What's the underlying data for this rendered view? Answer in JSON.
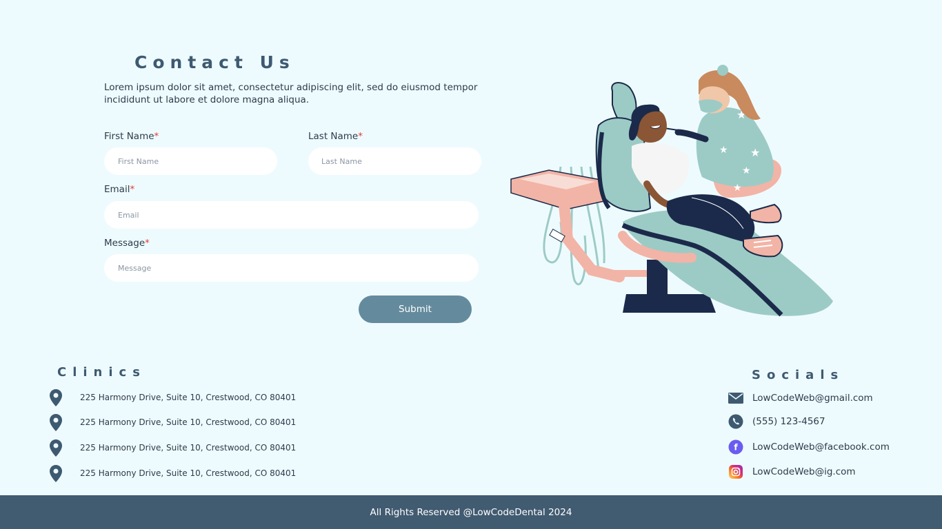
{
  "contact": {
    "title": "Contact Us",
    "description": "Lorem ipsum dolor sit amet, consectetur adipiscing elit, sed do eiusmod tempor incididunt ut labore et dolore magna aliqua."
  },
  "form": {
    "first_name": {
      "label": "First Name",
      "required_mark": "*",
      "placeholder": "First Name",
      "value": ""
    },
    "last_name": {
      "label": "Last Name",
      "required_mark": "*",
      "placeholder": "Last Name",
      "value": ""
    },
    "email": {
      "label": "Email",
      "required_mark": "*",
      "placeholder": "Email",
      "value": ""
    },
    "message": {
      "label": "Message",
      "required_mark": "*",
      "placeholder": "Message",
      "value": ""
    },
    "submit_label": "Submit"
  },
  "clinics": {
    "heading": "Clinics",
    "items": [
      {
        "address": "225 Harmony Drive, Suite 10, Crestwood, CO 80401",
        "icon": "location-pin-icon"
      },
      {
        "address": "225 Harmony Drive, Suite 10, Crestwood, CO 80401",
        "icon": "location-pin-icon"
      },
      {
        "address": "225 Harmony Drive, Suite 10, Crestwood, CO 80401",
        "icon": "location-pin-icon"
      },
      {
        "address": "225 Harmony Drive, Suite 10, Crestwood, CO 80401",
        "icon": "location-pin-icon"
      }
    ]
  },
  "socials": {
    "heading": "Socials",
    "items": [
      {
        "text": "LowCodeWeb@gmail.com",
        "icon": "mail-icon"
      },
      {
        "text": "(555) 123-4567",
        "icon": "phone-icon"
      },
      {
        "text": "LowCodeWeb@facebook.com",
        "icon": "facebook-icon"
      },
      {
        "text": "LowCodeWeb@ig.com",
        "icon": "instagram-icon"
      }
    ]
  },
  "footer": {
    "text": "All Rights Reserved @LowCodeDental 2024"
  },
  "colors": {
    "background": "#eefbfe",
    "heading": "#3e5a71",
    "button": "#648b9d",
    "footer": "#415b71",
    "required": "#e53935",
    "illustration_teal": "#9ccbc6",
    "illustration_pink": "#f2b4a6",
    "illustration_navy": "#1b2a4a"
  }
}
